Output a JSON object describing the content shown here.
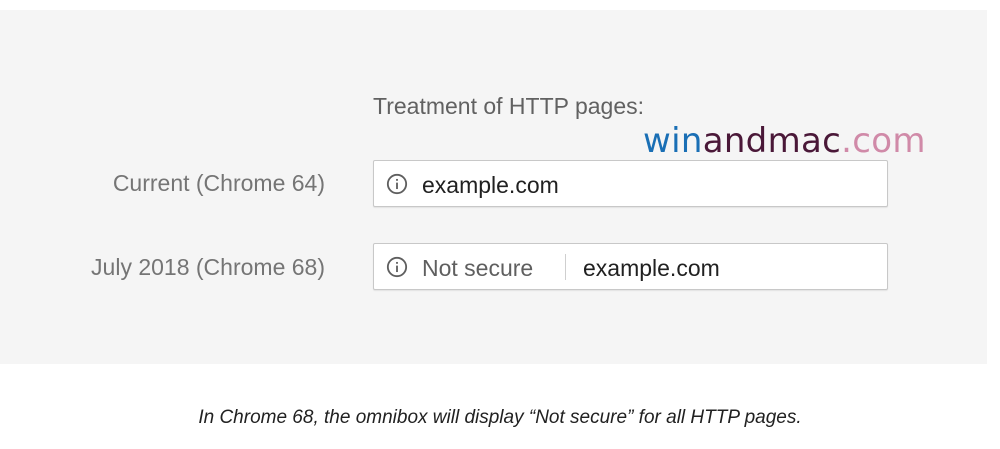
{
  "heading": "Treatment of HTTP pages:",
  "watermark": {
    "part1": "win",
    "part2": "and",
    "part3": "mac",
    "part4": ".com",
    "colors": {
      "part1": "#1a6fb5",
      "part2": "#4a1838",
      "part3": "#4a1838",
      "part4": "#d08aa8"
    }
  },
  "rows": [
    {
      "label": "Current (Chrome 64)",
      "icon": "info-icon",
      "url": "example.com"
    },
    {
      "label": "July 2018 (Chrome 68)",
      "icon": "info-icon",
      "security_label": "Not secure",
      "url": "example.com"
    }
  ],
  "caption": "In Chrome 68, the omnibox will display “Not secure” for all HTTP pages.",
  "colors": {
    "panel_bg": "#f5f5f5",
    "label_text": "#757575",
    "url_text": "#212121"
  }
}
